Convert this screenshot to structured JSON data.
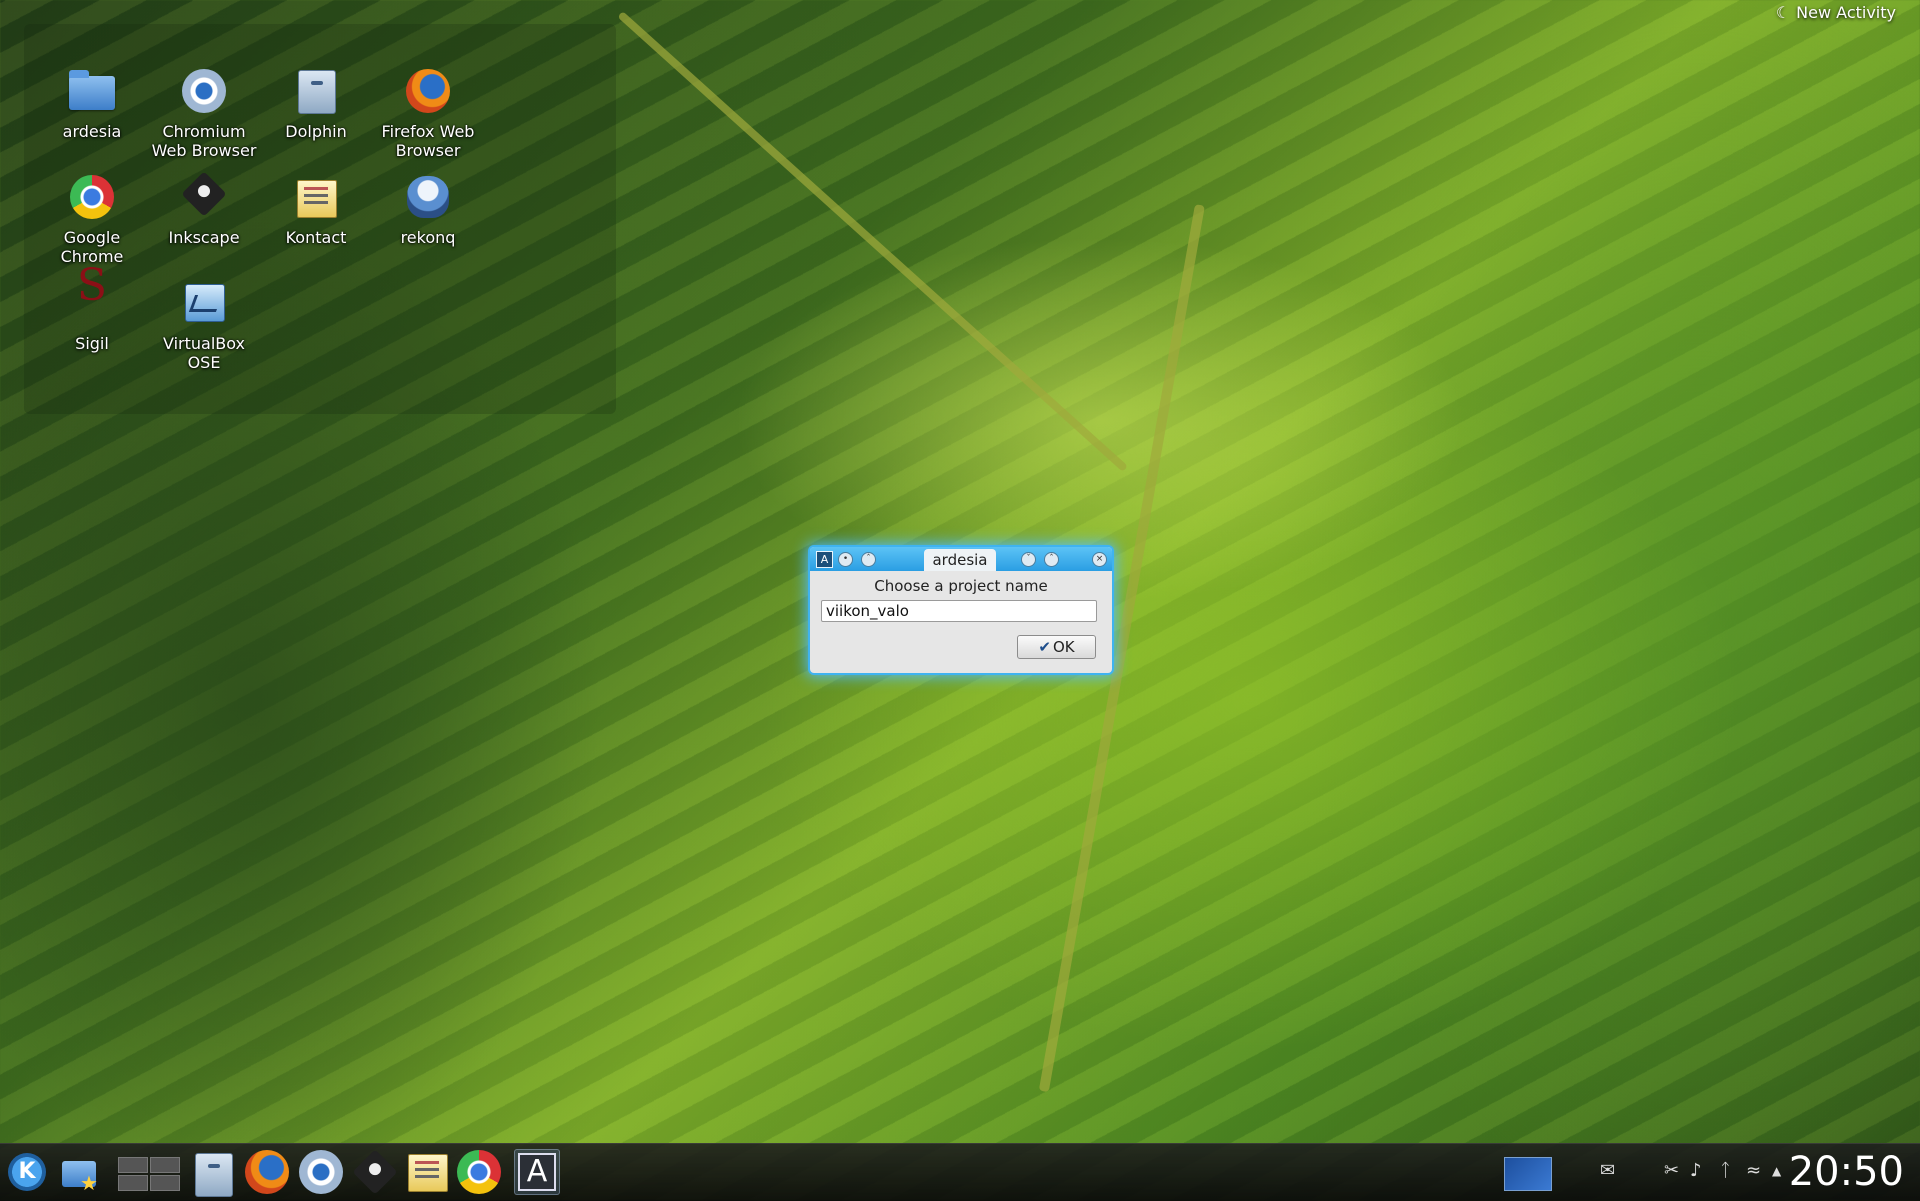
{
  "activity": {
    "label": "New Activity"
  },
  "desktop": {
    "icons": [
      {
        "label": "ardesia",
        "icon": "folder-icon"
      },
      {
        "label": "Chromium Web Browser",
        "icon": "chromium-icon"
      },
      {
        "label": "Dolphin",
        "icon": "dolphin-icon"
      },
      {
        "label": "Firefox Web Browser",
        "icon": "firefox-icon"
      },
      {
        "label": "Google Chrome",
        "icon": "chrome-icon"
      },
      {
        "label": "Inkscape",
        "icon": "inkscape-icon"
      },
      {
        "label": "Kontact",
        "icon": "kontact-icon"
      },
      {
        "label": "rekonq",
        "icon": "rekonq-icon"
      },
      {
        "label": "Sigil",
        "icon": "sigil-icon"
      },
      {
        "label": "VirtualBox OSE",
        "icon": "virtualbox-icon"
      }
    ]
  },
  "dialog": {
    "title": "ardesia",
    "app_glyph": "A",
    "prompt": "Choose a project name",
    "input_value": "viikon_valo",
    "ok_label": "OK",
    "accent": "#2a9ee3"
  },
  "taskbar": {
    "clock": "20:50",
    "tasks": [
      "kde-menu-icon",
      "folder-star-icon",
      "pager-icon",
      "dolphin-icon",
      "firefox-icon",
      "chromium-icon",
      "inkscape-icon",
      "kontact-icon",
      "chrome-icon",
      "ardesia-icon"
    ],
    "ardesia_glyph": "A",
    "sigil_glyph": "S"
  }
}
